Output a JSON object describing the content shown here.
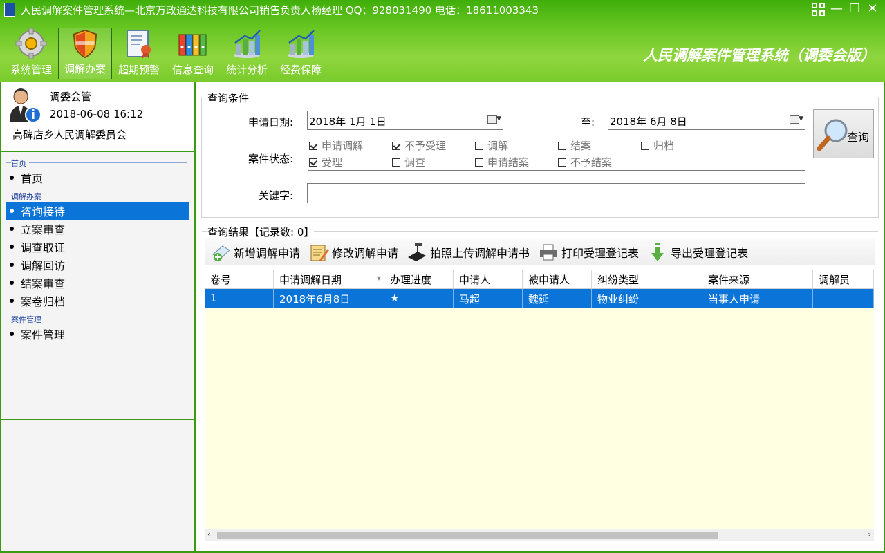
{
  "window": {
    "title": "人民调解案件管理系统—北京万政通达科技有限公司销售负责人杨经理 QQ：928031490 电话：18611003343"
  },
  "toolbar": {
    "items": [
      {
        "label": "系统管理",
        "icon": "gear-icon"
      },
      {
        "label": "调解办案",
        "icon": "shield-icon"
      },
      {
        "label": "超期预警",
        "icon": "certificate-icon"
      },
      {
        "label": "信息查询",
        "icon": "binders-icon"
      },
      {
        "label": "统计分析",
        "icon": "bar-chart-icon"
      },
      {
        "label": "经费保障",
        "icon": "bar-chart-icon"
      }
    ],
    "brand": "人民调解案件管理系统（调委会版）"
  },
  "user": {
    "role": "调委会管",
    "datetime": "2018-06-08 16:12",
    "org": "高碑店乡人民调解委员会"
  },
  "nav": {
    "group_home": "首页",
    "home": "首页",
    "group_case": "调解办案",
    "case_items": [
      "咨询接待",
      "立案审查",
      "调查取证",
      "调解回访",
      "结案审查",
      "案卷归档"
    ],
    "group_manage": "案件管理",
    "manage": "案件管理"
  },
  "query": {
    "legend": "查询条件",
    "date_label": "申请日期:",
    "date_from": "2018年  1月  1日",
    "to_label": "至:",
    "date_to": "2018年  6月  8日",
    "status_label": "案件状态:",
    "statuses": [
      {
        "label": "申请调解",
        "checked": true
      },
      {
        "label": "不予受理",
        "checked": true
      },
      {
        "label": "调解",
        "checked": false
      },
      {
        "label": "结案",
        "checked": false
      },
      {
        "label": "归档",
        "checked": false
      },
      {
        "label": "受理",
        "checked": true
      },
      {
        "label": "调查",
        "checked": false
      },
      {
        "label": "申请结案",
        "checked": false
      },
      {
        "label": "不予结案",
        "checked": false
      }
    ],
    "keyword_label": "关键字:",
    "keyword_value": "",
    "search_button": "查询"
  },
  "results": {
    "legend": "查询结果【记录数: 0】",
    "actions": [
      {
        "label": "新增调解申请",
        "icon": "add-document-icon"
      },
      {
        "label": "修改调解申请",
        "icon": "edit-notepad-icon"
      },
      {
        "label": "拍照上传调解申请书",
        "icon": "scanner-icon"
      },
      {
        "label": "打印受理登记表",
        "icon": "printer-icon"
      },
      {
        "label": "导出受理登记表",
        "icon": "download-arrow-icon"
      }
    ],
    "columns": [
      "卷号",
      "申请调解日期",
      "办理进度",
      "申请人",
      "被申请人",
      "纠纷类型",
      "案件来源",
      "调解员"
    ],
    "rows": [
      [
        "1",
        "2018年6月8日",
        "★",
        "马超",
        "魏延",
        "物业纠纷",
        "当事人申请",
        ""
      ]
    ]
  },
  "colors": {
    "header_green": "#63c31f",
    "border_green": "#3e9a13",
    "selection_blue": "#0a74d8",
    "grid_background": "#ffffe1"
  }
}
